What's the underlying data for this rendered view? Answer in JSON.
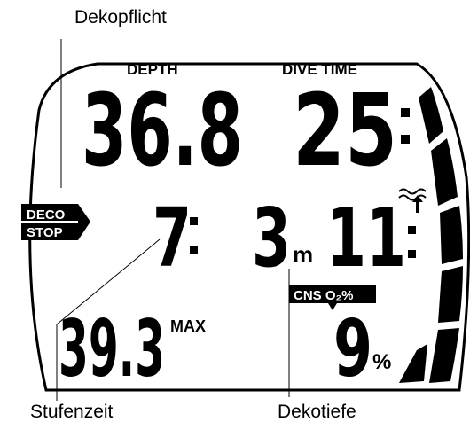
{
  "callouts": {
    "deco_light": "Dekopflicht",
    "stop_time": "Stufenzeit",
    "stop_depth": "Dekotiefe"
  },
  "display": {
    "depth_label": "DEPTH",
    "depth_value": "36.8",
    "dive_time_label": "DIVE TIME",
    "dive_time_value": "25",
    "deco_label": "DECO",
    "stop_label": "STOP",
    "stop_time_value": "7",
    "stop_depth_value": "3",
    "stop_depth_unit": "m",
    "ascent_time_value": "11",
    "max_depth_value": "39.3",
    "max_label": "MAX",
    "cns_label": "CNS O₂%",
    "cns_value": "9",
    "cns_unit": "%"
  },
  "colors": {
    "ink": "#000000",
    "background": "#ffffff"
  }
}
